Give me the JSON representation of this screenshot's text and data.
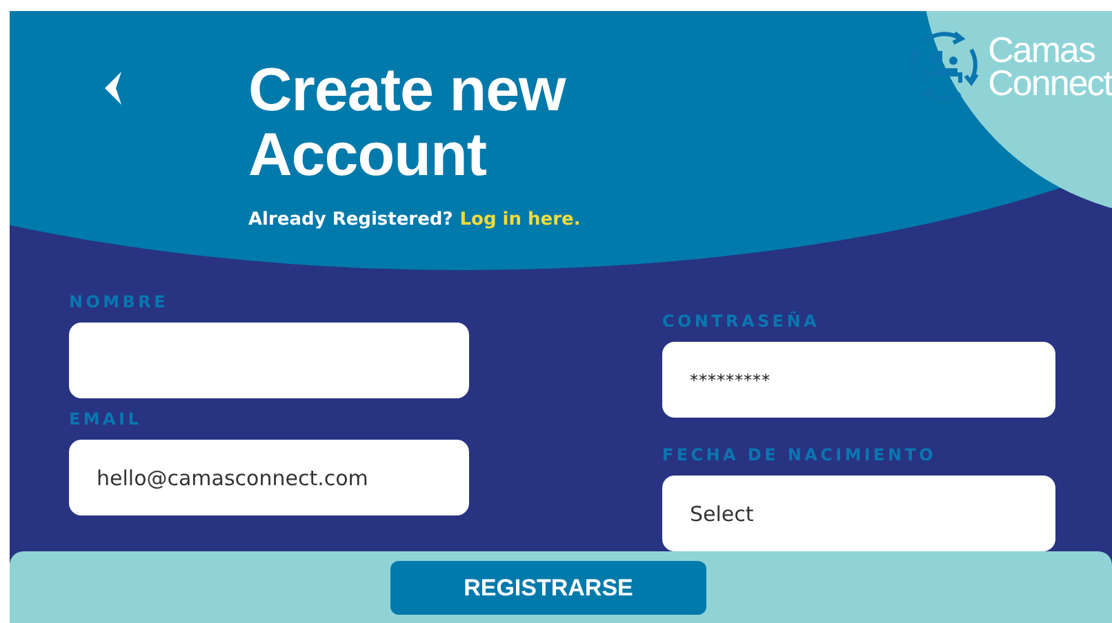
{
  "header": {
    "title": "Create new Account",
    "prompt": "Already Registered?",
    "login_link": "Log in here."
  },
  "logo": {
    "line_1": "Camas",
    "line_2": "Connect"
  },
  "fields": [
    {
      "label": "NOMBRE",
      "kind": "text"
    },
    {
      "label": "CONTRASEÑA",
      "kind": "password",
      "value": "*********"
    },
    {
      "label": "EMAIL",
      "kind": "text",
      "value": "hello@camasconnect.com"
    },
    {
      "label": "FECHA DE NACIMIENTO",
      "kind": "select",
      "value": "Select"
    }
  ],
  "submit": "REGISTRARSE"
}
